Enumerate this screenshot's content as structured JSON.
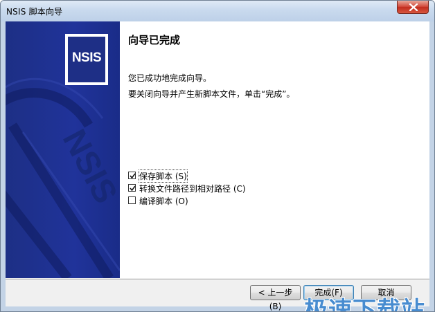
{
  "window": {
    "title": "NSIS 脚本向导"
  },
  "logo": {
    "text": "NSIS"
  },
  "content": {
    "heading": "向导已完成",
    "line1": "您已成功地完成向导。",
    "line2": "要关闭向导并产生新脚本文件，单击“完成”。"
  },
  "options": [
    {
      "label": "保存脚本 (S)",
      "checked": true
    },
    {
      "label": "转换文件路径到相对路径 (C)",
      "checked": true
    },
    {
      "label": "编译脚本 (O)",
      "checked": false
    }
  ],
  "buttons": {
    "back": "< 上一步 (B)",
    "finish": "完成(F)",
    "cancel": "取消"
  },
  "watermark": {
    "text": "极速下载站"
  },
  "colors": {
    "banner": "#20339a",
    "titlebar": "#c9daee",
    "close": "#c22d1f"
  }
}
